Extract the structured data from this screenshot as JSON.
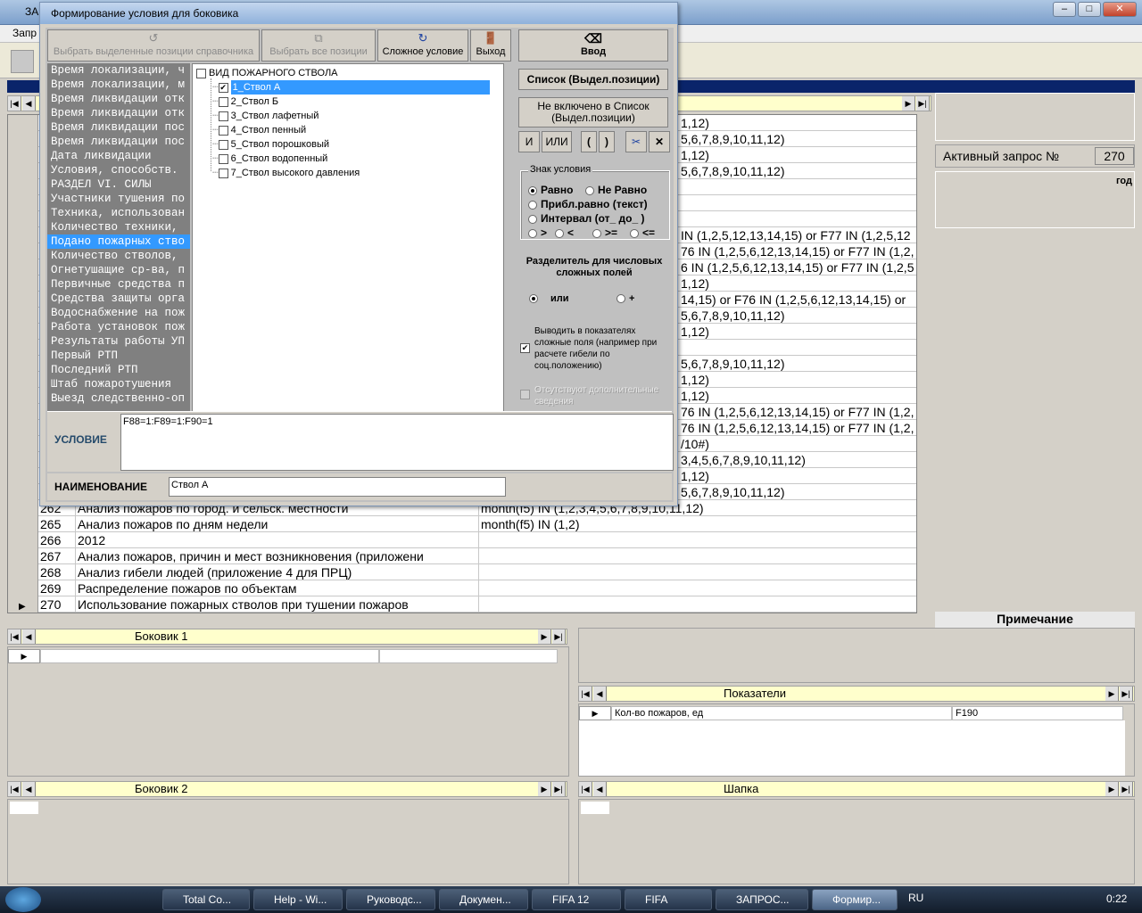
{
  "main_window": {
    "title": "ЗА",
    "menu_item": "Запр"
  },
  "dialog": {
    "title": "Формирование условия для боковика",
    "toolbar": {
      "select_selected": "Выбрать выделенные позиции справочника",
      "select_all": "Выбрать все позиции",
      "complex_condition": "Сложное условие",
      "exit": "Выход"
    },
    "enter_button": "Ввод",
    "list_button": "Список  (Выдел.позиции)",
    "not_in_list_button": "Не включено в Список (Выдел.позиции)",
    "ops": [
      "И",
      "ИЛИ",
      "(",
      ")",
      "✂",
      "✕"
    ],
    "fields": [
      "Время локализации, ч",
      "Время локализации, м",
      "Время ликвидации отк",
      "Время ликвидации отк",
      "Время ликвидации пос",
      "Время ликвидации пос",
      "Дата ликвидации",
      "Условия, способств.",
      "    РАЗДЕЛ VI. СИЛЫ",
      "Участники тушения по",
      "Техника, использован",
      "Количество техники,",
      "Подано пожарных ство",
      "Количество стволов,",
      "Огнетушащие ср-ва, п",
      "Первичные средства п",
      "Средства защиты орга",
      "Водоснабжение на пож",
      "Работа установок пож",
      "Результаты работы УП",
      "Первый РТП",
      "Последний РТП",
      "Штаб пожаротушения",
      "Выезд следственно-оп"
    ],
    "selected_field_index": 12,
    "tree_root": "ВИД ПОЖАРНОГО СТВОЛА",
    "tree_items": [
      {
        "label": "1_Ствол А",
        "checked": true
      },
      {
        "label": "2_Ствол Б",
        "checked": false
      },
      {
        "label": "3_Ствол лафетный",
        "checked": false
      },
      {
        "label": "4_Ствол пенный",
        "checked": false
      },
      {
        "label": "5_Ствол порошковый",
        "checked": false
      },
      {
        "label": "6_Ствол водопенный",
        "checked": false
      },
      {
        "label": "7_Ствол высокого давления",
        "checked": false
      }
    ],
    "sign_group_title": "Знак условия",
    "sign_equal": "Равно",
    "sign_not_equal": "Не Равно",
    "sign_approx": "Прибл.равно (текст)",
    "sign_interval": "Интервал (от_ до_ )",
    "sign_gt": ">",
    "sign_lt": "<",
    "sign_ge": ">=",
    "sign_le": "<=",
    "separator_title": "Разделитель для числовых сложных полей",
    "sep_or": "или",
    "sep_plus": "+",
    "show_complex": "Выводить в показателях сложные поля (например при расчете гибели по соц.положению)",
    "no_extra": "Отсутствуют дополнительные сведения",
    "condition_label": "УСЛОВИЕ",
    "condition_value": "F88=1:F89=1:F90=1",
    "name_label": "НАИМЕНОВАНИЕ",
    "name_value": "Ствол А"
  },
  "grid": {
    "cond_fragments": [
      "1,12)",
      "5,6,7,8,9,10,11,12)",
      "1,12)",
      "5,6,7,8,9,10,11,12)",
      "",
      "",
      "",
      "IN (1,2,5,12,13,14,15) or F77 IN (1,2,5,12",
      "76 IN (1,2,5,6,12,13,14,15) or F77 IN (1,2,",
      "6 IN (1,2,5,6,12,13,14,15) or F77 IN (1,2,5",
      "1,12)",
      "14,15) or F76 IN (1,2,5,6,12,13,14,15) or",
      "5,6,7,8,9,10,11,12)",
      "1,12)",
      "",
      "5,6,7,8,9,10,11,12)",
      "1,12)",
      "1,12)",
      "76 IN (1,2,5,6,12,13,14,15) or F77 IN (1,2,",
      "76 IN (1,2,5,6,12,13,14,15) or F77 IN (1,2,",
      "/10#)",
      "3,4,5,6,7,8,9,10,11,12)",
      "1,12)",
      "5,6,7,8,9,10,11,12)"
    ],
    "rows": [
      {
        "num": "262",
        "name": "Анализ пожаров по город. и сельск. местности",
        "cond": "month(f5) IN (1,2,3,4,5,6,7,8,9,10,11,12)"
      },
      {
        "num": "265",
        "name": "Анализ пожаров по дням недели",
        "cond": "month(f5) IN (1,2)"
      },
      {
        "num": "266",
        "name": "2012",
        "cond": ""
      },
      {
        "num": "267",
        "name": "Анализ пожаров, причин и мест возникновения (приложени",
        "cond": ""
      },
      {
        "num": "268",
        "name": "Анализ гибели людей (приложение 4 для ПРЦ)",
        "cond": ""
      },
      {
        "num": "269",
        "name": "Распределение пожаров по объектам",
        "cond": ""
      },
      {
        "num": "270",
        "name": "Использование пожарных стволов при тушении пожаров",
        "cond": ""
      }
    ],
    "current_row_marker": "▶"
  },
  "right_panel": {
    "active_label": "Активный запрос №",
    "active_value": "270",
    "year_label": "год",
    "note_label": "Примечание"
  },
  "panels": {
    "bokovik1": "Боковик 1",
    "bokovik2": "Боковик 2",
    "pokazateli": "Показатели",
    "shapka": "Шапка",
    "pok_row_name": "Кол-во пожаров, ед",
    "pok_row_code": "F190"
  },
  "taskbar": {
    "items": [
      "Total Co...",
      "Help - Wi...",
      "Руководс...",
      "Докумен...",
      "FIFA 12",
      "FIFA",
      "ЗАПРОС...",
      "Формир..."
    ],
    "active_index": 7,
    "lang": "RU",
    "time": "0:22"
  }
}
